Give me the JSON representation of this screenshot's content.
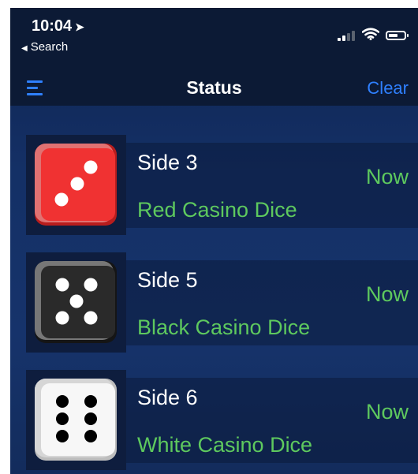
{
  "status_bar": {
    "time": "10:04",
    "location_icon": "location-arrow-icon",
    "back_label": "Search",
    "battery_level": 0.6
  },
  "nav": {
    "menu_icon": "hamburger-menu-icon",
    "title": "Status",
    "clear_label": "Clear"
  },
  "colors": {
    "accent": "#2f80ff",
    "success_text": "#5ec95e",
    "nav_background": "#0c1a35",
    "list_background": "#143066"
  },
  "items": [
    {
      "side": "Side 3",
      "name": "Red Casino Dice",
      "time": "Now",
      "icon": "red-dice-three-icon"
    },
    {
      "side": "Side 5",
      "name": "Black Casino Dice",
      "time": "Now",
      "icon": "black-dice-five-icon"
    },
    {
      "side": "Side 6",
      "name": "White Casino Dice",
      "time": "Now",
      "icon": "white-dice-six-icon"
    }
  ]
}
